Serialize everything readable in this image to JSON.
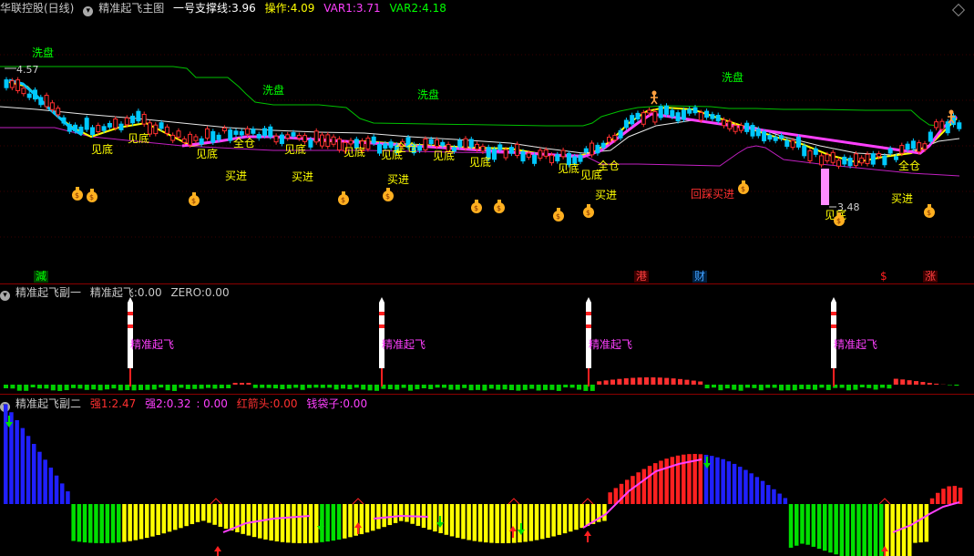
{
  "main_header": {
    "stock_name": "华联控股(日线)",
    "indicator_name": "精准起飞主图",
    "support_label": "一号支撑线:",
    "support_value": "3.96",
    "operate_label": "操作:",
    "operate_value": "4.09",
    "var1_label": "VAR1:",
    "var1_value": "3.71",
    "var2_label": "VAR2:",
    "var2_value": "4.18"
  },
  "price_labels": {
    "high": "4.57",
    "low": "3.48"
  },
  "signal_labels": {
    "wash": "洗盘",
    "bottom": "见底",
    "full": "全仓",
    "buy": "买进",
    "pullback_buy": "回踩买进"
  },
  "event_tags": [
    {
      "text": "減",
      "color": "#00ff00"
    },
    {
      "text": "港",
      "color": "#ff4040"
    },
    {
      "text": "财",
      "color": "#40a0ff"
    },
    {
      "text": "$",
      "color": "#ff2020"
    },
    {
      "text": "涨",
      "color": "#ff4040"
    }
  ],
  "sub1_header": {
    "name": "精准起飞副一",
    "indicator": "精准起飞:",
    "value": "0.00",
    "zero_label": "ZERO:",
    "zero_value": "0.00"
  },
  "sub1_label": "精准起飞",
  "sub2_header": {
    "name": "精准起飞副二",
    "s1_label": "强1:",
    "s1_value": "2.47",
    "s2_label": "强2:",
    "s2_value": "0.32",
    "s3_value": ": 0.00",
    "arrow_label": "红箭头:",
    "arrow_value": "0.00",
    "bag_label": "钱袋子:",
    "bag_value": "0.00"
  },
  "colors": {
    "up": "#ff3030",
    "down": "#00e0ff",
    "accent_yellow": "#ffff00",
    "accent_magenta": "#ff40ff",
    "accent_green": "#00ff00",
    "accent_blue": "#2020ff"
  }
}
